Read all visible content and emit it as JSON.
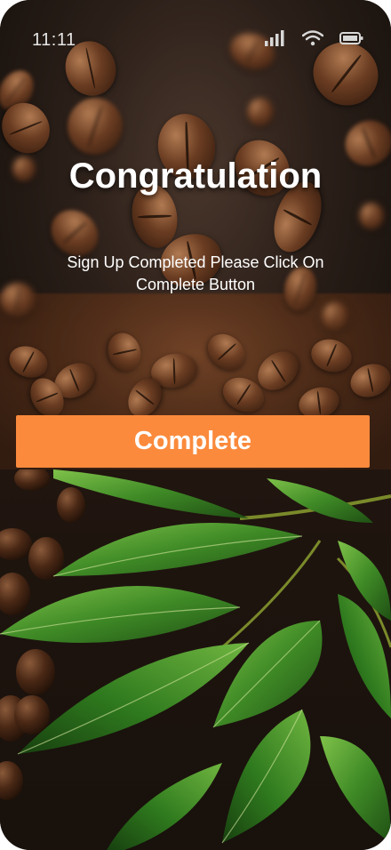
{
  "status_bar": {
    "time": "11:11",
    "icons": [
      "signal-icon",
      "wifi-icon",
      "battery-icon"
    ]
  },
  "main": {
    "title": "Congratulation",
    "subtitle": "Sign Up Completed Please Click On Complete Button",
    "complete_label": "Complete"
  },
  "colors": {
    "accent": "#fb8a3c",
    "text": "#ffffff"
  },
  "background": {
    "top_image": "coffee-beans-image",
    "bottom_image": "coffee-leaves-image"
  }
}
